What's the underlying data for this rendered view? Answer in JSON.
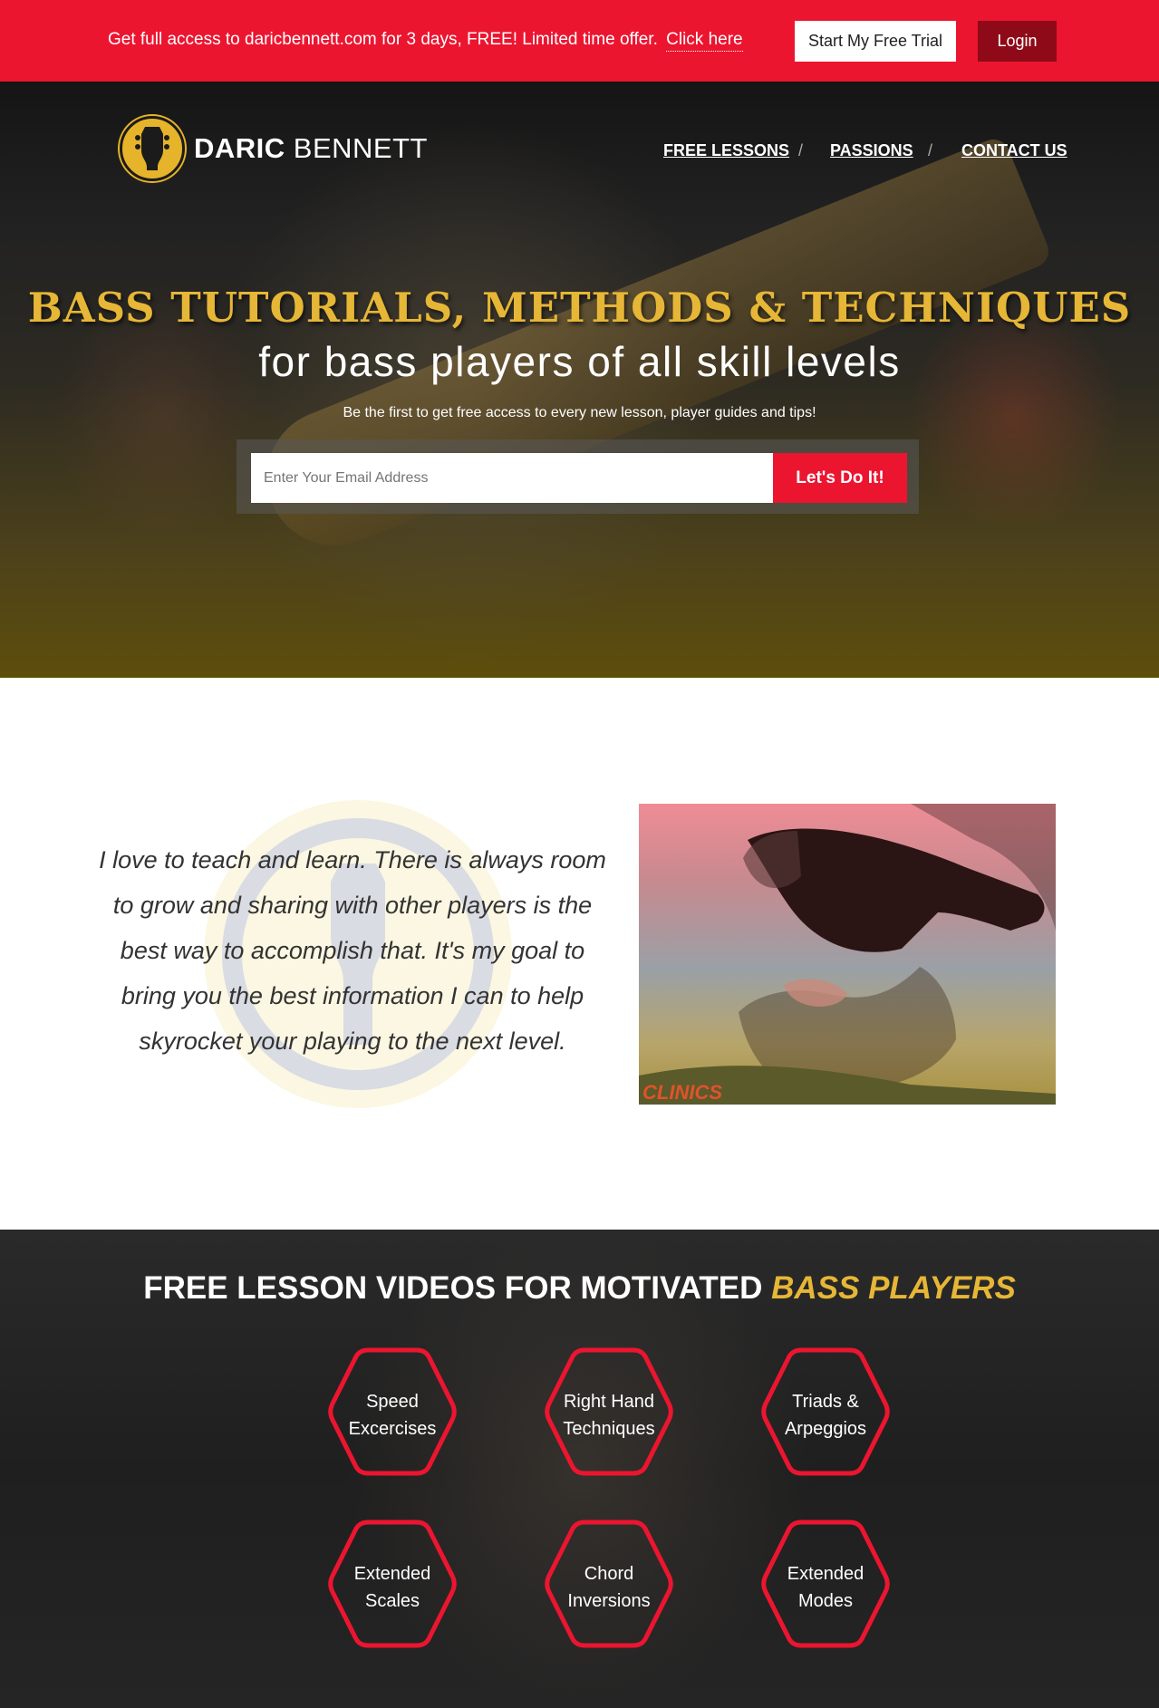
{
  "topbar": {
    "promo_text": "Get full access to daricbennett.com for 3 days, FREE! Limited time offer.",
    "promo_link": "Click here",
    "trial_button": "Start My Free Trial",
    "login_button": "Login"
  },
  "header": {
    "logo_first": "DARIC",
    "logo_last": "BENNETT",
    "nav": [
      "FREE LESSONS",
      "PASSIONS",
      "CONTACT US"
    ],
    "nav_separator": "/"
  },
  "hero": {
    "title": "BASS TUTORIALS, METHODS & TECHNIQUES",
    "subtitle": "for bass players of all skill levels",
    "note": "Be the first to get free access to every new lesson, player guides and tips!",
    "email_placeholder": "Enter Your Email Address",
    "submit_label": "Let's Do It!"
  },
  "about": {
    "quote": "I love to teach and learn. There is always room to grow and sharing with other players is the best way to accomplish that. It's my goal to bring you the best information I can to help skyrocket your playing to the next level.",
    "portrait_caption": "CLINICS"
  },
  "lessons": {
    "title_main": "FREE LESSON VIDEOS FOR MOTIVATED",
    "title_highlight": "BASS PLAYERS",
    "items": [
      {
        "line1": "Speed",
        "line2": "Excercises"
      },
      {
        "line1": "Right Hand",
        "line2": "Techniques"
      },
      {
        "line1": "Triads &",
        "line2": "Arpeggios"
      },
      {
        "line1": "Extended",
        "line2": "Scales"
      },
      {
        "line1": "Chord",
        "line2": "Inversions"
      },
      {
        "line1": "Extended",
        "line2": "Modes"
      }
    ]
  },
  "colors": {
    "brand_red": "#ec1530",
    "login_red": "#8f0a18",
    "gold": "#e6b636"
  }
}
